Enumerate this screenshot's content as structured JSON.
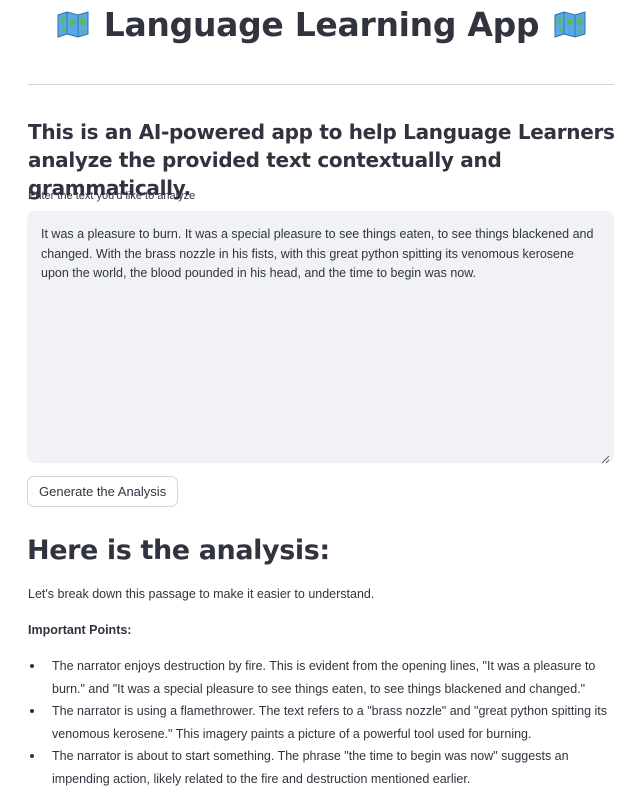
{
  "header": {
    "title": "Language Learning App",
    "left_icon": "world-map-icon",
    "right_icon": "world-map-icon"
  },
  "description": "This is an AI-powered app to help Language Learners analyze the provided text contextually and grammatically.",
  "input": {
    "label": "Enter the text you'd like to analyze",
    "value": "It was a pleasure to burn. It was a special pleasure to see things eaten, to see things blackened and changed. With the brass nozzle in his fists, with this great python spitting its venomous kerosene upon the world, the blood pounded in his head, and the time to begin was now."
  },
  "button": {
    "label": "Generate the Analysis"
  },
  "analysis": {
    "heading": "Here is the analysis:",
    "intro": "Let's break down this passage to make it easier to understand.",
    "points_heading": "Important Points:",
    "points": [
      "The narrator enjoys destruction by fire. This is evident from the opening lines, \"It was a pleasure to burn.\" and \"It was a special pleasure to see things eaten, to see things blackened and changed.\"",
      "The narrator is using a flamethrower. The text refers to a \"brass nozzle\" and \"great python spitting its venomous kerosene.\" This imagery paints a picture of a powerful tool used for burning.",
      "The narrator is about to start something. The phrase \"the time to begin was now\" suggests an impending action, likely related to the fire and destruction mentioned earlier."
    ]
  },
  "colors": {
    "text": "#31333f",
    "textarea_bg": "#f0f2f6",
    "divider": "#d6d6d9",
    "button_border": "#d3d4d8"
  }
}
